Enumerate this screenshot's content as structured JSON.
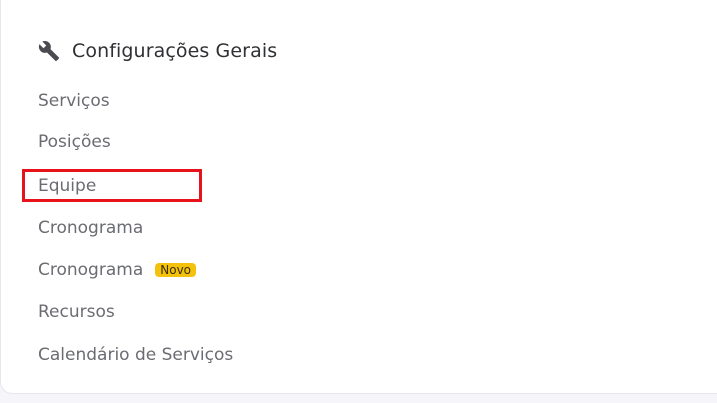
{
  "section": {
    "title": "Configurações Gerais",
    "icon": "wrench-icon"
  },
  "menu": {
    "items": [
      {
        "label": "Serviços"
      },
      {
        "label": "Posições"
      },
      {
        "label": "Equipe",
        "highlighted": true
      },
      {
        "label": "Cronograma"
      },
      {
        "label": "Cronograma",
        "badge": "Novo"
      },
      {
        "label": "Recursos"
      },
      {
        "label": "Calendário de Serviços"
      }
    ]
  },
  "colors": {
    "highlight_border": "#e8121a",
    "badge_background": "#f4c20d"
  }
}
